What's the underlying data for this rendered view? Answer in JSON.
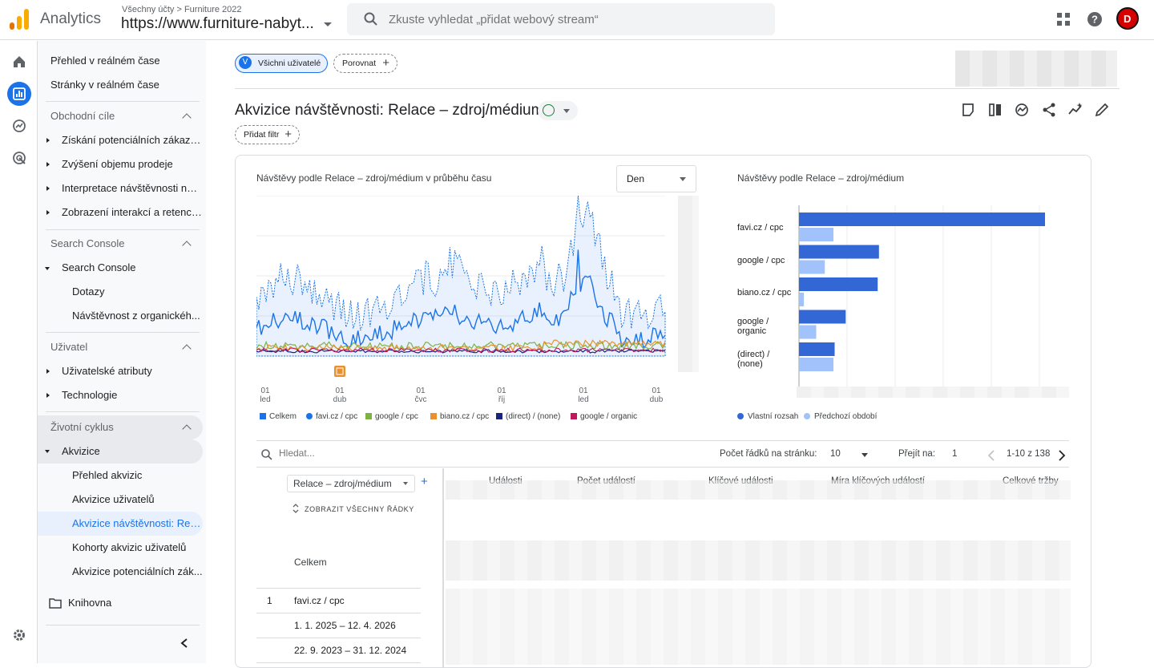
{
  "header": {
    "app_title": "Analytics",
    "breadcrumb": "Všechny účty > Furniture 2022",
    "property": "https://www.furniture-nabyt...",
    "search_placeholder": "Zkuste vyhledat „přidat webový stream“",
    "avatar_letter": "D",
    "icons": [
      "apps-grid-icon",
      "help-icon"
    ]
  },
  "nav": {
    "realtime_overview": "Přehled v reálném čase",
    "realtime_pages": "Stránky v reálném čase",
    "business_goals": "Obchodní cíle",
    "goals": [
      "Získání potenciálních zákazní...",
      "Zvýšení objemu prodeje",
      "Interpretace návštěvnosti na ...",
      "Zobrazení interakcí a retence..."
    ],
    "search_console_head": "Search Console",
    "search_console": "Search Console",
    "queries": "Dotazy",
    "organic": "Návštěvnost z organickéh...",
    "user_head": "Uživatel",
    "user_attributes": "Uživatelské atributy",
    "technology": "Technologie",
    "lifecycle": "Životní cyklus",
    "acquisition": "Akvizice",
    "acq_items": [
      "Přehled akvizic",
      "Akvizice uživatelů",
      "Akvizice návštěvnosti: Rela...",
      "Kohorty akvizic uživatelů",
      "Akvizice potenciálních zák..."
    ],
    "library": "Knihovna"
  },
  "toolbar": {
    "segment_letter": "V",
    "segment": "Všichni uživatelé",
    "compare": "Porovnat",
    "add_filter": "Přidat filtr",
    "report_title": "Akvizice návštěvnosti: Relace – zdroj/médium"
  },
  "chart_left": {
    "title": "Návštěvy podle Relace – zdroj/médium v průběhu času",
    "granularity": "Den",
    "ticks": [
      {
        "day": "01",
        "month": "led"
      },
      {
        "day": "01",
        "month": "dub"
      },
      {
        "day": "01",
        "month": "čvc"
      },
      {
        "day": "01",
        "month": "říj"
      },
      {
        "day": "01",
        "month": "led"
      },
      {
        "day": "01",
        "month": "dub"
      }
    ],
    "legend": [
      {
        "name": "Celkem",
        "color": "#1a73e8"
      },
      {
        "name": "favi.cz / cpc",
        "color": "#1a73e8"
      },
      {
        "name": "google / cpc",
        "color": "#7cb342"
      },
      {
        "name": "biano.cz / cpc",
        "color": "#e8912d"
      },
      {
        "name": "(direct) / (none)",
        "color": "#1a237e"
      },
      {
        "name": "google / organic",
        "color": "#c2185b"
      }
    ]
  },
  "chart_data": {
    "type": "bar",
    "title": "Návštěvy podle Relace – zdroj/médium",
    "categories": [
      "favi.cz / cpc",
      "google / cpc",
      "biano.cz / cpc",
      "google / organic",
      "(direct) / (none)"
    ],
    "series": [
      {
        "name": "Vlastní rozsah",
        "color": "#3367d6",
        "values": [
          100,
          32.5,
          32,
          19,
          14.5
        ]
      },
      {
        "name": "Předchozí období",
        "color": "#a1c2fa",
        "values": [
          14,
          10.5,
          2,
          7,
          14
        ]
      }
    ]
  },
  "table": {
    "search_placeholder": "Hledat...",
    "rows_per_page_label": "Počet řádků na stránku:",
    "rows_per_page": "10",
    "goto_label": "Přejít na:",
    "goto_value": "1",
    "range": "1-10 z 138",
    "dimension": "Relace – zdroj/médium",
    "show_all": "ZOBRAZIT VŠECHNY ŘÁDKY",
    "columns": [
      "Události",
      "Počet událostí",
      "Klíčové události",
      "Míra klíčových událostí",
      "Celkové tržby"
    ],
    "total_label": "Celkem",
    "rows": [
      {
        "index": "1",
        "label": "favi.cz / cpc"
      },
      {
        "index": "",
        "label": "1. 1. 2025 – 12. 4. 2026"
      },
      {
        "index": "",
        "label": "22. 9. 2023 – 31. 12. 2024"
      }
    ]
  }
}
